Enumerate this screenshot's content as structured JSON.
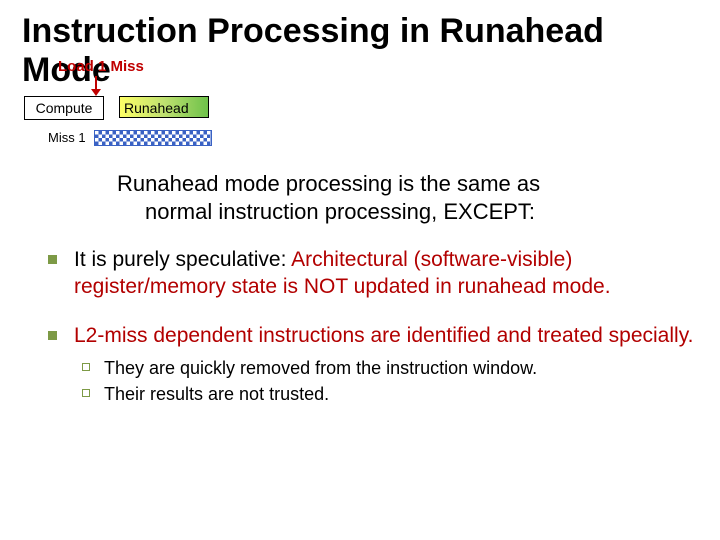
{
  "title_l1": "Instruction Processing in Runahead",
  "title_l2": "Mode",
  "diagram": {
    "load_label": "Load 1 Miss",
    "compute": "Compute",
    "runahead": "Runahead",
    "miss1_label": "Miss 1"
  },
  "intro_l1": "Runahead mode processing is the same as",
  "intro_l2": "normal instruction processing, EXCEPT:",
  "bullets": [
    {
      "pre": "It is purely speculative: ",
      "red": "Architectural (software-visible) register/memory state is NOT updated in runahead mode."
    },
    {
      "pre": "",
      "red": "L2-miss dependent instructions are identified and treated specially.",
      "subs": [
        "They are quickly removed from the instruction window.",
        "Their results are not trusted."
      ]
    }
  ]
}
